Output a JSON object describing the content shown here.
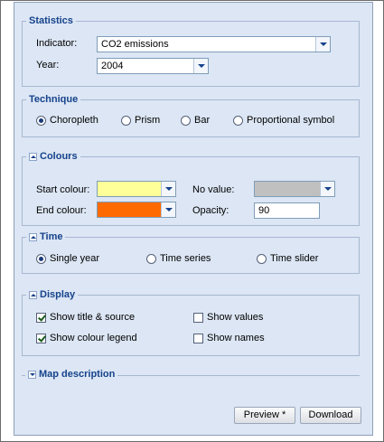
{
  "statistics": {
    "legend": "Statistics",
    "indicator_label": "Indicator:",
    "indicator_value": "CO2 emissions",
    "year_label": "Year:",
    "year_value": "2004"
  },
  "technique": {
    "legend": "Technique",
    "options": [
      "Choropleth",
      "Prism",
      "Bar",
      "Proportional symbol"
    ],
    "selected": "Choropleth"
  },
  "colours": {
    "legend": "Colours",
    "start_label": "Start colour:",
    "start_color": "#ffff99",
    "end_label": "End colour:",
    "end_color": "#ff6a00",
    "novalue_label": "No value:",
    "novalue_color": "#c0c0c0",
    "opacity_label": "Opacity:",
    "opacity_value": "90"
  },
  "time": {
    "legend": "Time",
    "options": [
      "Single year",
      "Time series",
      "Time slider"
    ],
    "selected": "Single year"
  },
  "display": {
    "legend": "Display",
    "options": [
      {
        "label": "Show title & source",
        "checked": true
      },
      {
        "label": "Show values",
        "checked": false
      },
      {
        "label": "Show colour legend",
        "checked": true
      },
      {
        "label": "Show names",
        "checked": false
      }
    ]
  },
  "map_description": {
    "legend": "Map description"
  },
  "buttons": {
    "preview": "Preview *",
    "download": "Download"
  },
  "colors": {
    "panel_bg": "#dce6f4",
    "legend_text": "#15428b",
    "border": "#a7b8d2"
  }
}
